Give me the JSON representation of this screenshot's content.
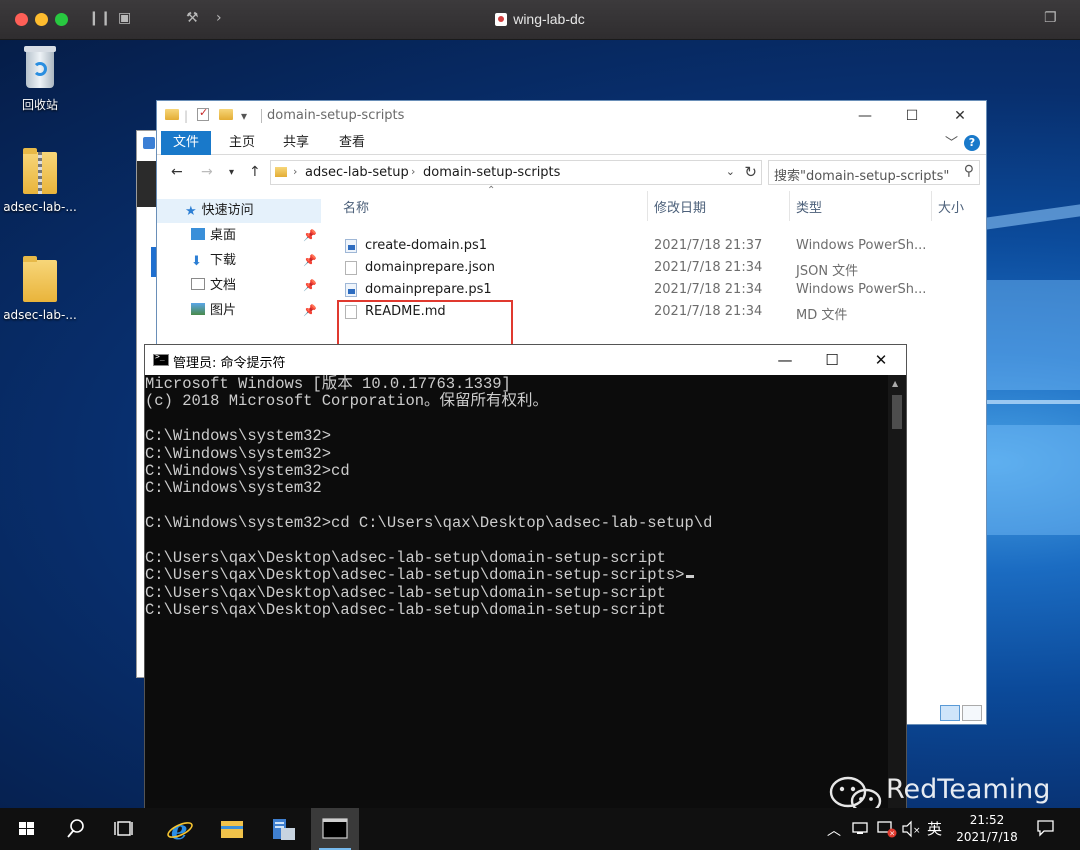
{
  "vm": {
    "title": "wing-lab-dc"
  },
  "desktop": {
    "icons": [
      {
        "label": "回收站"
      },
      {
        "label": "adsec-lab-..."
      },
      {
        "label": "adsec-lab-..."
      }
    ]
  },
  "explorer": {
    "title": "domain-setup-scripts",
    "ribbon_tabs": [
      "文件",
      "主页",
      "共享",
      "查看"
    ],
    "breadcrumb": [
      "adsec-lab-setup",
      "domain-setup-scripts"
    ],
    "search_placeholder": "搜索\"domain-setup-scripts\"",
    "sidebar": [
      {
        "label": "快速访问"
      },
      {
        "label": "桌面"
      },
      {
        "label": "下载"
      },
      {
        "label": "文档"
      },
      {
        "label": "图片"
      }
    ],
    "columns": {
      "name": "名称",
      "modified": "修改日期",
      "type": "类型",
      "size": "大小"
    },
    "files": [
      {
        "name": "create-domain.ps1",
        "modified": "2021/7/18 21:37",
        "type": "Windows PowerSh..."
      },
      {
        "name": "domainprepare.json",
        "modified": "2021/7/18 21:34",
        "type": "JSON 文件"
      },
      {
        "name": "domainprepare.ps1",
        "modified": "2021/7/18 21:34",
        "type": "Windows PowerSh..."
      },
      {
        "name": "README.md",
        "modified": "2021/7/18 21:34",
        "type": "MD 文件"
      }
    ]
  },
  "cmd": {
    "title": "管理员: 命令提示符",
    "lines": [
      "Microsoft Windows [版本 10.0.17763.1339]",
      "(c) 2018 Microsoft Corporation。保留所有权利。",
      "",
      "C:\\Windows\\system32>",
      "C:\\Windows\\system32>",
      "C:\\Windows\\system32>cd",
      "C:\\Windows\\system32",
      "",
      "C:\\Windows\\system32>cd C:\\Users\\qax\\Desktop\\adsec-lab-setup\\d",
      "",
      "C:\\Users\\qax\\Desktop\\adsec-lab-setup\\domain-setup-script",
      "C:\\Users\\qax\\Desktop\\adsec-lab-setup\\domain-setup-scripts>",
      "C:\\Users\\qax\\Desktop\\adsec-lab-setup\\domain-setup-script",
      "C:\\Users\\qax\\Desktop\\adsec-lab-setup\\domain-setup-script"
    ]
  },
  "watermark": {
    "text": "RedTeaming"
  },
  "taskbar": {
    "ime": "英",
    "time": "21:52",
    "date": "2021/7/18"
  }
}
